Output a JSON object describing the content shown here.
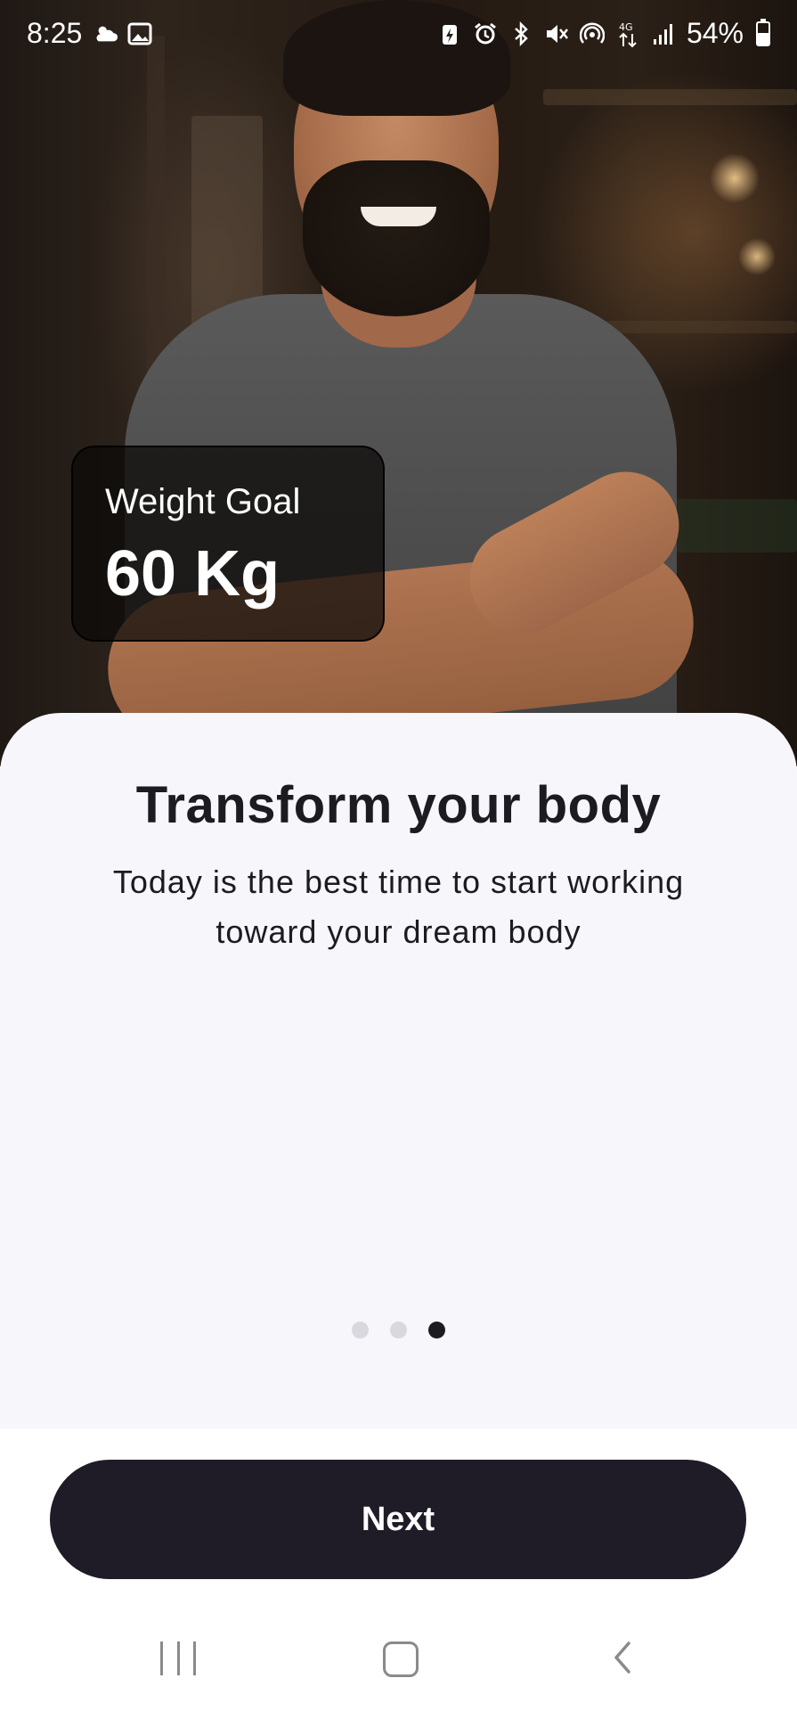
{
  "status_bar": {
    "time": "8:25",
    "battery_percent": "54%",
    "left_icons": [
      "weather-icon",
      "image-icon"
    ],
    "right_icons": [
      "battery-saver-icon",
      "alarm-icon",
      "bluetooth-icon",
      "mute-icon",
      "hotspot-icon",
      "data-4g-icon",
      "signal-icon",
      "battery-icon"
    ]
  },
  "goal_card": {
    "label": "Weight Goal",
    "value": "60 Kg"
  },
  "onboarding": {
    "title": "Transform your body",
    "subtitle": "Today is the best time to start working toward your dream body",
    "page_count": 3,
    "active_page": 3
  },
  "actions": {
    "next_label": "Next"
  },
  "nav_bar": {
    "icons": [
      "recents-icon",
      "home-icon",
      "back-icon"
    ]
  },
  "colors": {
    "sheet_bg": "#f7f6fb",
    "text_primary": "#1d1b22",
    "button_bg": "#1f1b27",
    "dot_inactive": "#d9d8de",
    "dot_active": "#1d1b22"
  }
}
